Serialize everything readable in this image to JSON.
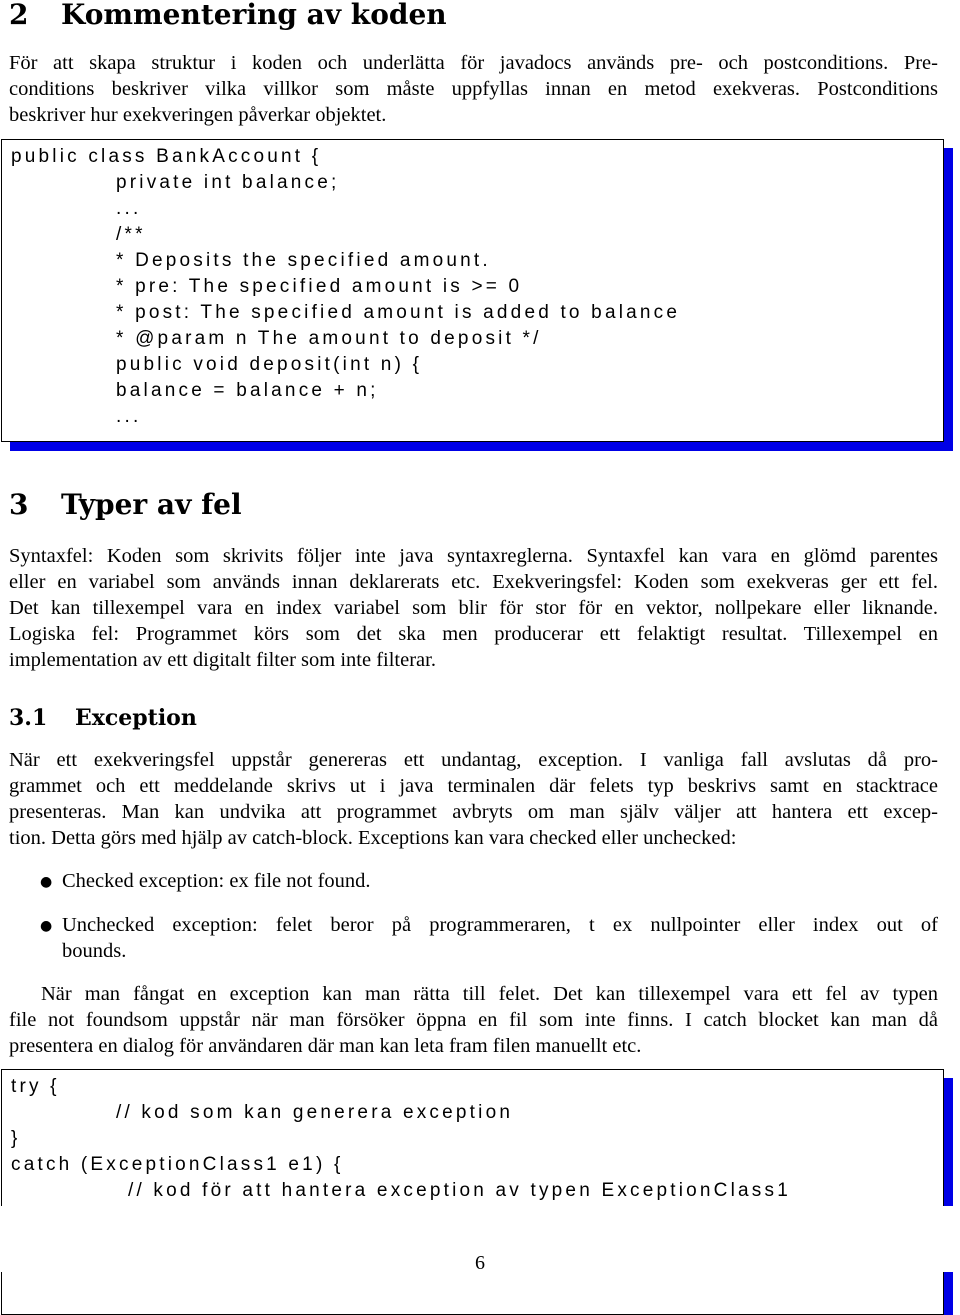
{
  "section2": {
    "number": "2",
    "title": "Kommentering av koden",
    "paragraph": [
      "För att skapa struktur i koden och underlätta för javadocs används pre- och postconditions. Pre-",
      "conditions beskriver vilka villkor som måste uppfyllas innan en metod exekveras. Postconditions",
      "beskriver hur exekveringen påverkar objektet."
    ],
    "code": [
      {
        "indent": 0,
        "text": "public class BankAccount {"
      },
      {
        "indent": 1,
        "text": "private int balance;"
      },
      {
        "indent": 1,
        "text": "..."
      },
      {
        "indent": 1,
        "text": "/**"
      },
      {
        "indent": 1,
        "text": "* Deposits the specified amount."
      },
      {
        "indent": 1,
        "text": "* pre: The specified amount is >= 0"
      },
      {
        "indent": 1,
        "text": "* post: The specified amount is added to balance"
      },
      {
        "indent": 1,
        "text": "* @param n The amount to deposit */"
      },
      {
        "indent": 1,
        "text": "public void deposit(int n) {"
      },
      {
        "indent": 1,
        "text": "balance = balance + n;"
      },
      {
        "indent": 1,
        "text": "..."
      }
    ]
  },
  "section3": {
    "number": "3",
    "title": "Typer av fel",
    "paragraph": [
      "Syntaxfel: Koden som skrivits följer inte java syntaxreglerna. Syntaxfel kan vara en glömd parentes",
      "eller en variabel som används innan deklarerats etc. Exekveringsfel: Koden som exekveras ger ett fel.",
      "Det kan tillexempel vara en index variabel som blir för stor för en vektor, nollpekare eller liknande.",
      "Logiska fel: Programmet körs som det ska men producerar ett felaktigt resultat. Tillexempel en",
      "implementation av ett digitalt filter som inte filterar."
    ]
  },
  "section31": {
    "number": "3.1",
    "title": "Exception",
    "paragraph": [
      "När ett exekveringsfel uppstår genereras ett undantag, exception. I vanliga fall avslutas då pro-",
      "grammet och ett meddelande skrivs ut i java terminalen där felets typ beskrivs samt en stacktrace",
      "presenteras. Man kan undvika att programmet avbryts om man själv väljer att hantera ett excep-",
      "tion. Detta görs med hjälp av catch-block. Exceptions kan vara checked eller unchecked:"
    ],
    "bullets": [
      [
        "Checked exception: ex file not found."
      ],
      [
        "Unchecked exception: felet beror på programmeraren, t ex nullpointer eller index out of",
        "bounds."
      ]
    ],
    "paragraph2": [
      "När man fångat en exception kan man rätta till felet. Det kan tillexempel vara ett fel av typen",
      "file not foundsom uppstår när man försöker öppna en fil som inte finns. I catch blocket kan man då",
      "presentera en dialog för användaren där man kan leta fram filen manuellt etc."
    ],
    "code": [
      {
        "indent": 0,
        "text": "try {"
      },
      {
        "indent": 1,
        "text": "// kod som kan generera exception"
      },
      {
        "indent": 0,
        "text": "}"
      },
      {
        "indent": 0,
        "text": "catch (ExceptionClass1 e1) {"
      },
      {
        "indent": 2,
        "text": "// kod för att hantera exception av typen ExceptionClass1"
      }
    ]
  },
  "page_number": "6",
  "colors": {
    "code_shadow": "#0000e6"
  }
}
